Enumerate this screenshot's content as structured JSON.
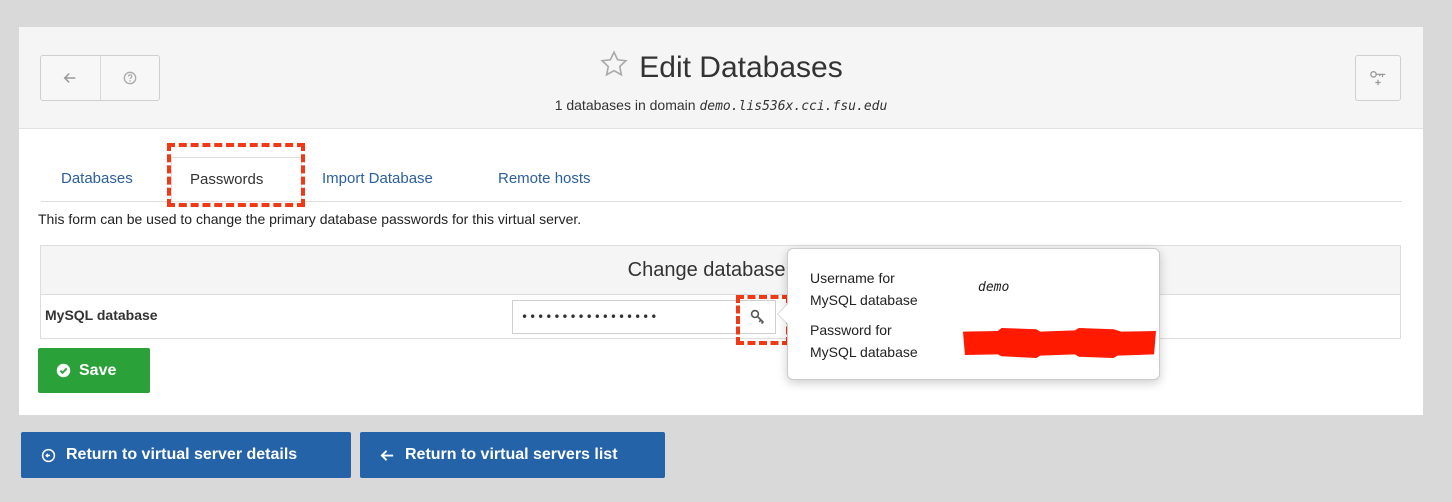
{
  "header": {
    "title": "Edit Databases",
    "subtitle_prefix": "1 databases in domain",
    "domain": "demo.lis536x.cci.fsu.edu"
  },
  "tabs": [
    {
      "label": "Databases"
    },
    {
      "label": "Passwords"
    },
    {
      "label": "Import Database"
    },
    {
      "label": "Remote hosts"
    }
  ],
  "description": "This form can be used to change the primary database passwords for this virtual server.",
  "form": {
    "heading": "Change database pa",
    "row_label": "MySQL database",
    "password_value": "•••••••••••••••••"
  },
  "popover": {
    "username_label_1": "Username for",
    "username_label_2": "MySQL database",
    "username_value": "demo",
    "password_label_1": "Password for",
    "password_label_2": "MySQL database"
  },
  "buttons": {
    "save": "Save",
    "return_details": "Return to virtual server details",
    "return_list": "Return to virtual servers list"
  },
  "colors": {
    "accent_blue": "#2563a9",
    "save_green": "#2ba13a",
    "highlight_red": "#f03a17"
  }
}
